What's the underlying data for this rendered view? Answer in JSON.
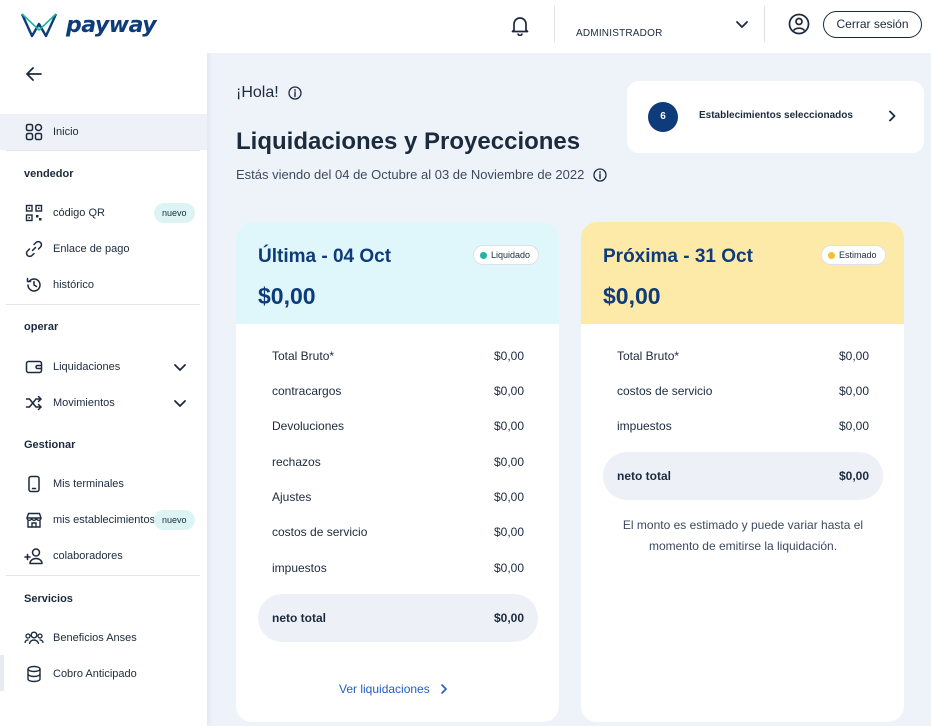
{
  "brand": {
    "name": "payway"
  },
  "sidebar": {
    "items": [
      {
        "label": "Inicio"
      },
      {
        "label": "código QR",
        "badge": "nuevo"
      },
      {
        "label": "Enlace de pago"
      },
      {
        "label": "histórico"
      },
      {
        "label": "Liquidaciones"
      },
      {
        "label": "Movimientos"
      },
      {
        "label": "Mis terminales"
      },
      {
        "label": "mis establecimientos",
        "badge": "nuevo"
      },
      {
        "label": "colaboradores"
      },
      {
        "label": "Beneficios Anses"
      },
      {
        "label": "Cobro Anticipado"
      }
    ],
    "sections": [
      "vendedor",
      "operar",
      "Gestionar",
      "Servicios"
    ]
  },
  "header": {
    "role": "ADMINISTRADOR",
    "logout_label": "Cerrar sesión"
  },
  "main": {
    "greeting": "¡Hola!",
    "title": "Liquidaciones y Proyecciones",
    "subtitle": "Estás viendo del 04 de Octubre al 03 de Noviembre de 2022",
    "establishments": {
      "count": "6",
      "label": "Establecimientos seleccionados"
    }
  },
  "cards": [
    {
      "title": "Última - 04 Oct",
      "amount": "$0,00",
      "status": "Liquidado",
      "status_color": "#1fb3a6",
      "head_color": "#dff7fb",
      "rows": [
        {
          "label": "Total Bruto*",
          "value": "$0,00"
        },
        {
          "label": "contracargos",
          "value": "$0,00"
        },
        {
          "label": "Devoluciones",
          "value": "$0,00"
        },
        {
          "label": "rechazos",
          "value": "$0,00"
        },
        {
          "label": "Ajustes",
          "value": "$0,00"
        },
        {
          "label": "costos de servicio",
          "value": "$0,00"
        },
        {
          "label": "impuestos",
          "value": "$0,00"
        }
      ],
      "net": {
        "label": "neto total",
        "value": "$0,00"
      },
      "link": "Ver liquidaciones"
    },
    {
      "title": "Próxima - 31 Oct",
      "amount": "$0,00",
      "status": "Estimado",
      "status_color": "#f2c12e",
      "head_color": "#fdeaa8",
      "rows": [
        {
          "label": "Total Bruto*",
          "value": "$0,00"
        },
        {
          "label": "costos de servicio",
          "value": "$0,00"
        },
        {
          "label": "impuestos",
          "value": "$0,00"
        }
      ],
      "net": {
        "label": "neto total",
        "value": "$0,00"
      },
      "note": "El monto es estimado y puede variar hasta el momento de emitirse la liquidación."
    }
  ]
}
